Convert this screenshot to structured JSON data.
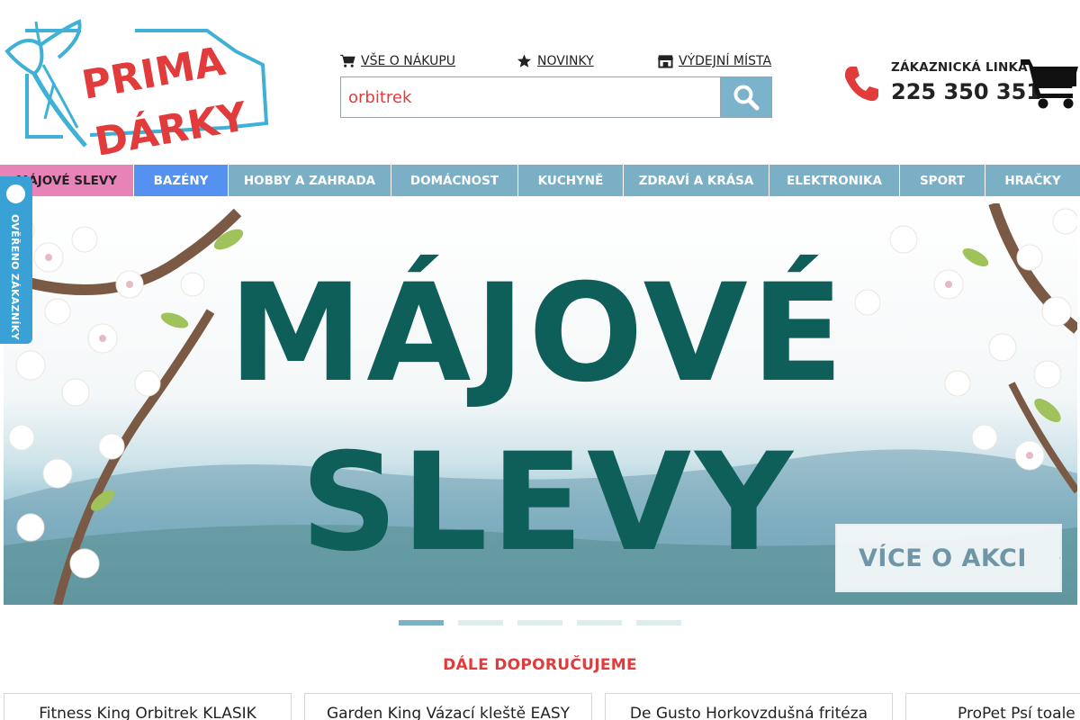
{
  "logo": {
    "line1": "PRIMA",
    "line2": "DÁRKY",
    "ribbon_color": "#3fb1d6",
    "text_color": "#e23b3b"
  },
  "header": {
    "links": [
      {
        "label": "VŠE O NÁKUPU",
        "icon": "cart-icon"
      },
      {
        "label": "NOVINKY",
        "icon": "star-icon"
      },
      {
        "label": "VÝDEJNÍ MÍSTA",
        "icon": "store-icon"
      }
    ],
    "search": {
      "value": "orbitrek",
      "placeholder": "orbitrek"
    },
    "customer_line": {
      "label": "ZÁKAZNICKÁ LINKA",
      "number": "225 350 351"
    }
  },
  "nav": {
    "items": [
      {
        "label": "MÁJOVÉ SLEVY"
      },
      {
        "label": "BAZÉNY"
      },
      {
        "label": "HOBBY A ZAHRADA"
      },
      {
        "label": "DOMÁCNOST"
      },
      {
        "label": "KUCHYNĚ"
      },
      {
        "label": "ZDRAVÍ A KRÁSA"
      },
      {
        "label": "ELEKTRONIKA"
      },
      {
        "label": "SPORT"
      },
      {
        "label": "HRAČKY"
      }
    ],
    "active_index": 1,
    "special_index": 0
  },
  "badge": {
    "label": "OVĚŘENO ZÁKAZNÍKY"
  },
  "banner": {
    "line1": "MÁJOVÉ",
    "line2": "SLEVY",
    "cta": "VÍCE O AKCI",
    "slides_total": 5,
    "active_slide": 1
  },
  "recommend": {
    "title": "DÁLE DOPORUČUJEME",
    "products": [
      {
        "name": "Fitness King Orbitrek KLASIK"
      },
      {
        "name": "Garden King Vázací kleště EASY"
      },
      {
        "name": "De Gusto Horkovzdušná fritéza"
      },
      {
        "name": "ProPet Psí toale"
      }
    ]
  },
  "colors": {
    "accent_red": "#e23b3b",
    "nav_blue": "#7aafc6",
    "nav_active": "#5591f0",
    "nav_special": "#e883b7",
    "banner_text": "#0e5e59"
  }
}
